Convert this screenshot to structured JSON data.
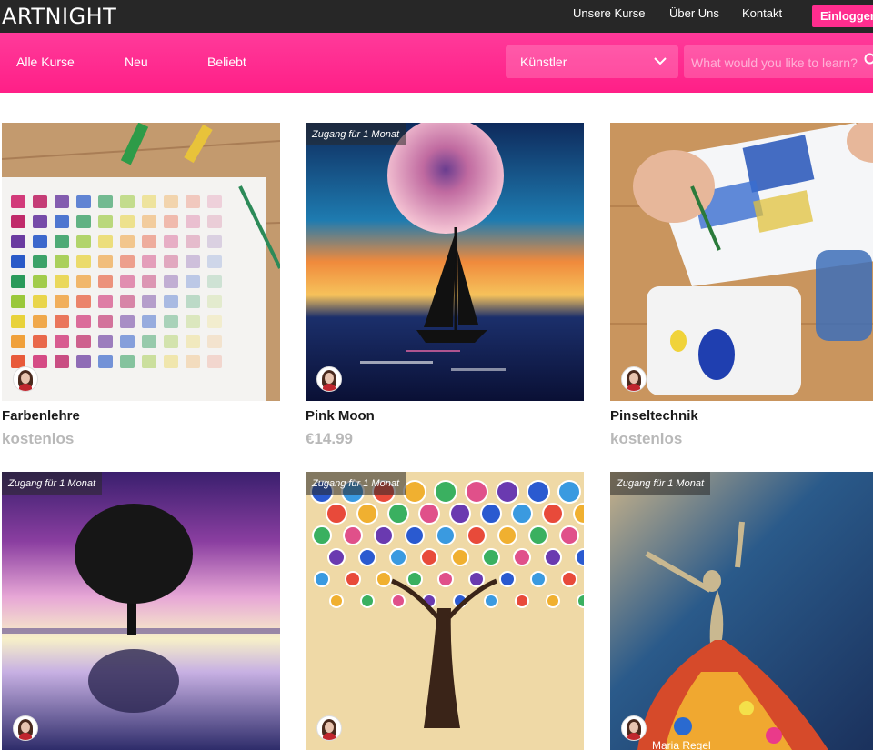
{
  "header": {
    "logo": "ARTNIGHT",
    "nav": [
      "Unsere Kurse",
      "Über Uns",
      "Kontakt"
    ],
    "login_label": "Einloggen"
  },
  "filter_bar": {
    "tabs": [
      "Alle Kurse",
      "Neu",
      "Beliebt"
    ],
    "select_value": "Künstler",
    "search_placeholder": "What would you like to learn?"
  },
  "courses": [
    {
      "title": "Farbenlehre",
      "price": "kostenlos",
      "badge": ""
    },
    {
      "title": "Pink Moon",
      "price": "€14.99",
      "badge": "Zugang für 1 Monat"
    },
    {
      "title": "Pinseltechnik",
      "price": "kostenlos",
      "badge": ""
    },
    {
      "title": "",
      "price": "",
      "badge": "Zugang für 1 Monat"
    },
    {
      "title": "",
      "price": "",
      "badge": "Zugang für 1 Monat"
    },
    {
      "title": "",
      "price": "",
      "badge": "Zugang für 1 Monat",
      "artist": "Maria Regel"
    }
  ],
  "colors": {
    "accent": "#ff2d8e",
    "topbar": "#272727",
    "muted_price": "#b8b8b8"
  }
}
